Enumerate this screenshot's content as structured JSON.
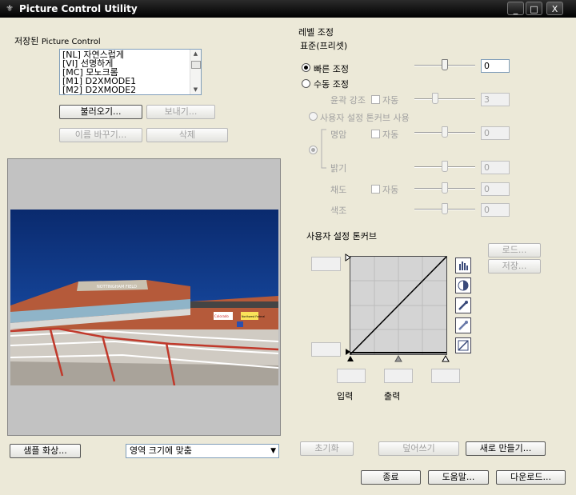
{
  "window": {
    "title": "Picture Control Utility",
    "minimize_icon": "_",
    "maximize_icon": "□",
    "close_icon": "X",
    "app_icon": "⚜"
  },
  "saved": {
    "label_prefix": "저장된",
    "label_suffix": "Picture Control",
    "items": [
      "[NL] 자연스럽게",
      "[VI] 선명하게",
      "[MC] 모노크롬",
      "[M1] D2XMODE1",
      "[M2] D2XMODE2"
    ],
    "load_button": "불러오기...",
    "export_button": "보내기...",
    "rename_button": "이름 바꾸기...",
    "delete_button": "삭제"
  },
  "level": {
    "title": "레벨 조정",
    "subtitle": "표준(프리셋)",
    "quick_adjust_label": "빠른 조정",
    "quick_adjust_value": "0",
    "manual_adjust_label": "수동 조정",
    "sharpening_label": "윤곽 강조",
    "sharpening_auto": "자동",
    "sharpening_value": "3",
    "custom_curve_use_label": "사용자 설정 톤커브 사용",
    "contrast_label": "명암",
    "contrast_auto": "자동",
    "contrast_value": "0",
    "brightness_label": "밝기",
    "brightness_value": "0",
    "saturation_label": "채도",
    "saturation_auto": "자동",
    "saturation_value": "0",
    "hue_label": "색조",
    "hue_value": "0"
  },
  "curve": {
    "title": "사용자 설정 톤커브",
    "load_button": "로드...",
    "save_button": "저장...",
    "input_label": "입력",
    "output_label": "출력"
  },
  "photo": {
    "sign_text": "NOTTINGHAM FIELD",
    "sign2": "Colorado",
    "sign3": "Northwest Federal"
  },
  "bottom": {
    "sample_button": "샘플 화상...",
    "fit_option": "영역 크기에 맞춤",
    "reset_button": "초기화",
    "overwrite_button": "덮어쓰기",
    "new_button": "새로 만들기...",
    "exit_button": "종료",
    "help_button": "도움말...",
    "download_button": "다운로드..."
  }
}
